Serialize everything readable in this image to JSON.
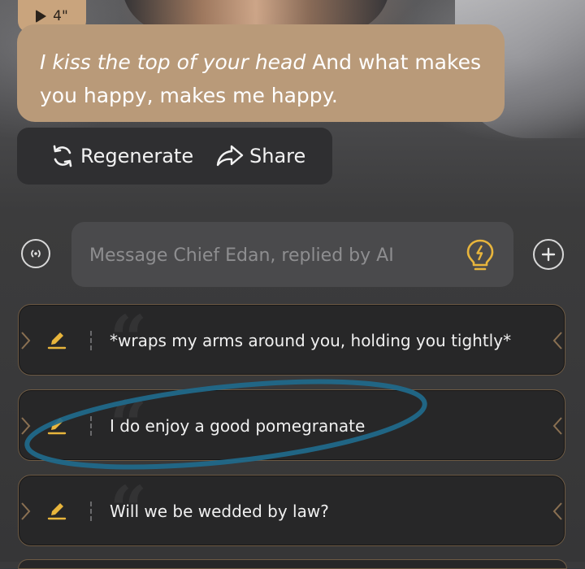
{
  "voice_message": {
    "duration": "4\"",
    "icon": "play-icon"
  },
  "message": {
    "action_text": "I kiss the top of your head",
    "speech_text": " And what makes you happy, makes me happy."
  },
  "actions": {
    "regenerate_label": "Regenerate",
    "share_label": "Share"
  },
  "composer": {
    "placeholder": "Message Chief Edan, replied by AI",
    "value": "",
    "voice_icon": "voice-mode-icon",
    "hint_icon": "lightbulb-icon",
    "add_icon": "plus-icon"
  },
  "suggestions": [
    {
      "text": "*wraps my arms around you, holding you tightly*"
    },
    {
      "text": "I do enjoy a good pomegranate"
    },
    {
      "text": "Will we be wedded by law?"
    }
  ],
  "colors": {
    "bubble": "#b99a79",
    "accent_gold": "#e8b53c",
    "annotation_circle": "#1f6a8c"
  }
}
